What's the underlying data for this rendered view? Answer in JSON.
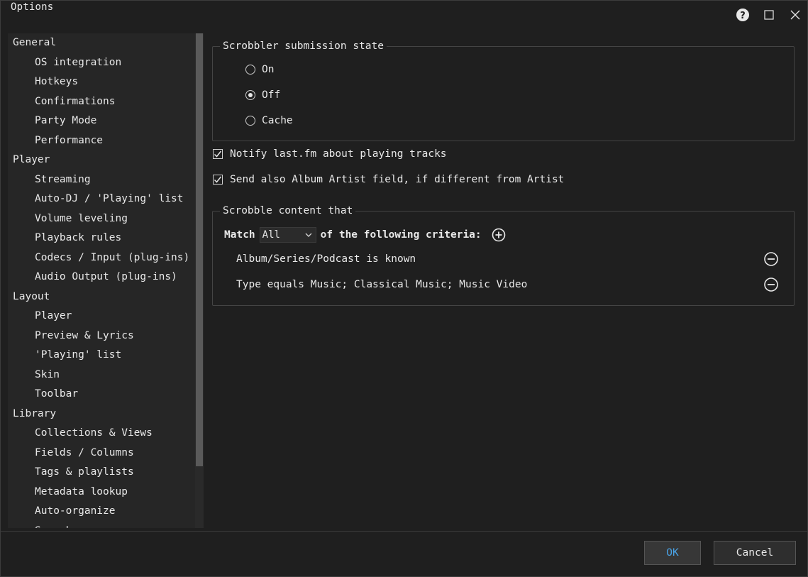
{
  "window": {
    "title": "Options",
    "icons": [
      "help-icon",
      "maximize-icon",
      "close-icon"
    ]
  },
  "sidebar": {
    "items": [
      {
        "label": "General",
        "level": 0
      },
      {
        "label": "OS integration",
        "level": 1
      },
      {
        "label": "Hotkeys",
        "level": 1
      },
      {
        "label": "Confirmations",
        "level": 1
      },
      {
        "label": "Party Mode",
        "level": 1
      },
      {
        "label": "Performance",
        "level": 1
      },
      {
        "label": "Player",
        "level": 0
      },
      {
        "label": "Streaming",
        "level": 1
      },
      {
        "label": "Auto-DJ / 'Playing' list",
        "level": 1
      },
      {
        "label": "Volume leveling",
        "level": 1
      },
      {
        "label": "Playback rules",
        "level": 1
      },
      {
        "label": "Codecs / Input (plug-ins)",
        "level": 1
      },
      {
        "label": "Audio Output (plug-ins)",
        "level": 1
      },
      {
        "label": "Layout",
        "level": 0
      },
      {
        "label": "Player",
        "level": 1
      },
      {
        "label": "Preview & Lyrics",
        "level": 1
      },
      {
        "label": "'Playing' list",
        "level": 1
      },
      {
        "label": "Skin",
        "level": 1
      },
      {
        "label": "Toolbar",
        "level": 1
      },
      {
        "label": "Library",
        "level": 0
      },
      {
        "label": "Collections & Views",
        "level": 1
      },
      {
        "label": "Fields / Columns",
        "level": 1
      },
      {
        "label": "Tags & playlists",
        "level": 1
      },
      {
        "label": "Metadata lookup",
        "level": 1
      },
      {
        "label": "Auto-organize",
        "level": 1
      },
      {
        "label": "Search",
        "level": 1
      }
    ]
  },
  "scrobbler": {
    "group_title": "Scrobbler submission state",
    "options": [
      {
        "label": "On",
        "checked": false
      },
      {
        "label": "Off",
        "checked": true
      },
      {
        "label": "Cache",
        "checked": false
      }
    ]
  },
  "checkboxes": [
    {
      "label": "Notify last.fm about playing tracks",
      "checked": true
    },
    {
      "label": "Send also Album Artist field, if different from Artist",
      "checked": true
    }
  ],
  "content": {
    "group_title": "Scrobble content that",
    "match_label": "Match",
    "match_value": "All",
    "criteria_label": "of the following criteria:",
    "criteria": [
      "Album/Series/Podcast is known",
      "Type equals Music; Classical Music; Music Video"
    ]
  },
  "buttons": {
    "ok": "OK",
    "cancel": "Cancel"
  },
  "colors": {
    "background": "#1f1f1f",
    "accent": "#4aa3e6",
    "text": "#e8e8e8"
  }
}
